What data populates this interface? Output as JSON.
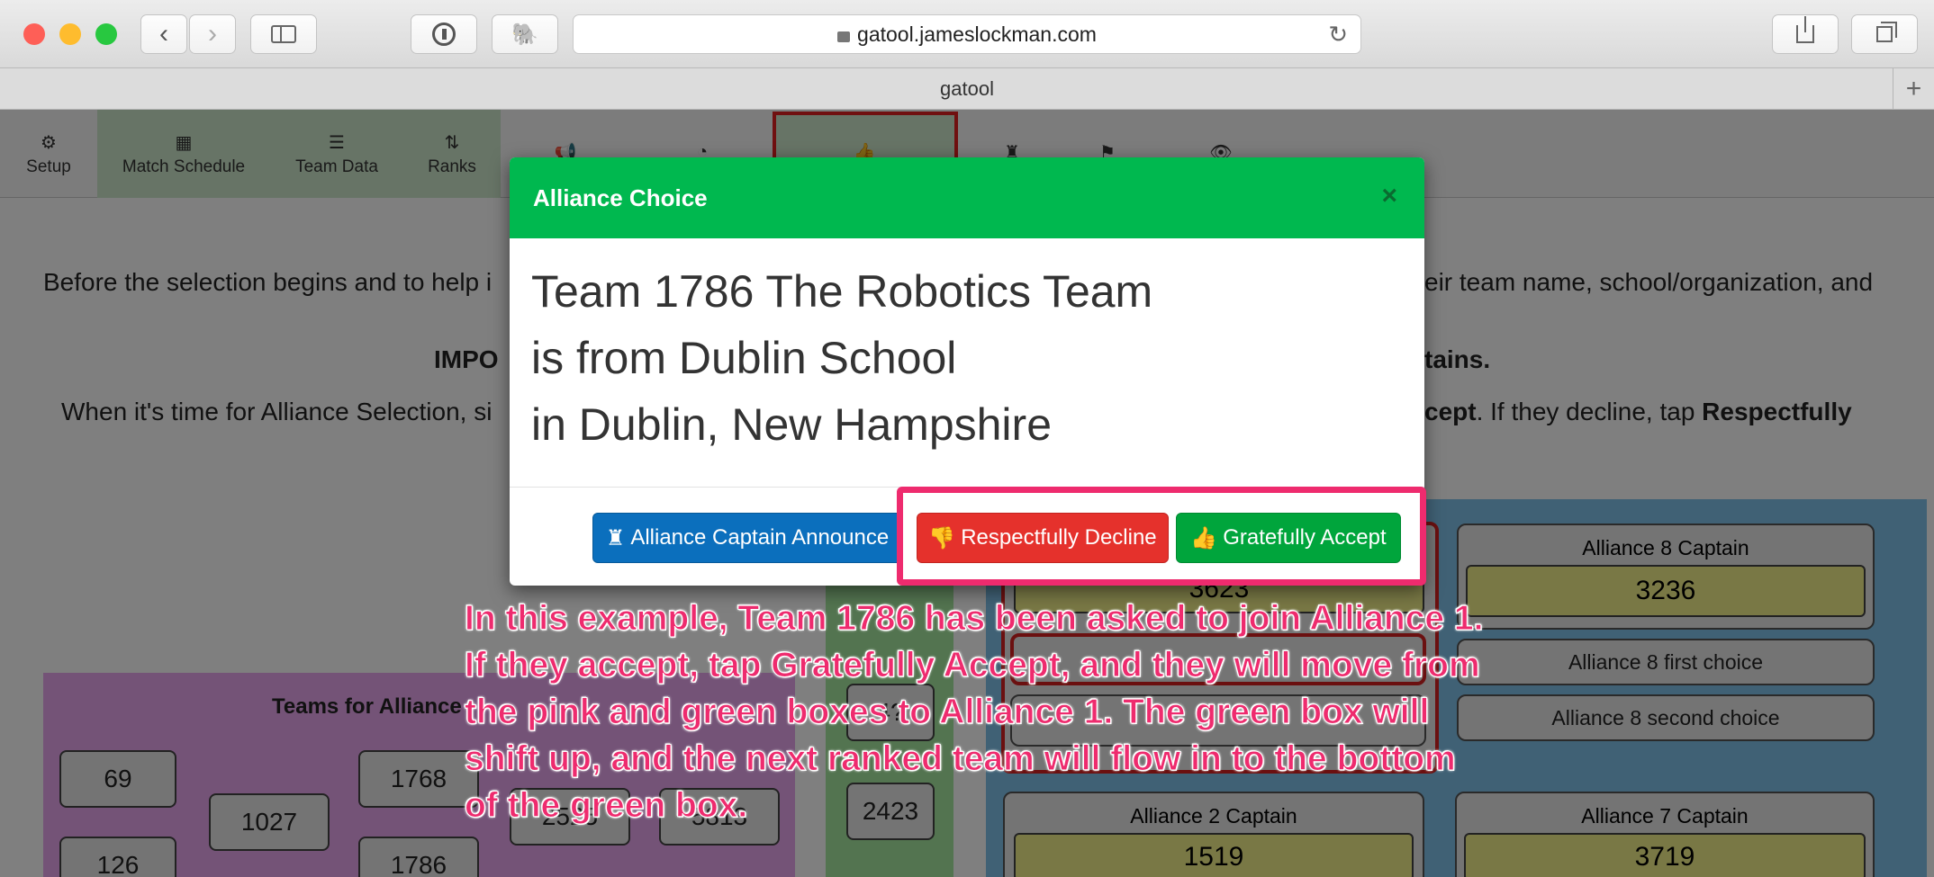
{
  "browser": {
    "url": "gatool.jameslockman.com",
    "tab_title": "gatool"
  },
  "nav": {
    "items": [
      {
        "label": "Setup",
        "icon": "gear-icon"
      },
      {
        "label": "Match Schedule",
        "icon": "calendar-icon"
      },
      {
        "label": "Team Data",
        "icon": "list-icon"
      },
      {
        "label": "Ranks",
        "icon": "sort-icon"
      },
      {
        "label": "",
        "icon": "megaphone-icon"
      },
      {
        "label": "",
        "icon": "gauge-icon"
      },
      {
        "label": "",
        "icon": "thumbs-up-icon"
      },
      {
        "label": "",
        "icon": "rook-icon"
      },
      {
        "label": "",
        "icon": "flag-icon"
      },
      {
        "label": "",
        "icon": "eye-icon"
      }
    ]
  },
  "page": {
    "para1_left": "Before the selection begins and to help i",
    "para1_right": "eir team name, school/organization, and",
    "important_left": "IMPO",
    "important_right": "tains.",
    "para2_left": "When it's time for Alliance Selection, si",
    "para2_accept": "cept",
    "para2_mid": ". If they decline, tap ",
    "para2_respect": "Respectfully"
  },
  "teams_panel": {
    "title": "Teams for Alliance",
    "teams": [
      "69",
      "1027",
      "1768",
      "126",
      "1786",
      "2525",
      "5813"
    ]
  },
  "green_panel": {
    "teams": [
      "4?",
      "2423"
    ]
  },
  "alliances": {
    "a8_captain_label": "Alliance 8 Captain",
    "a8_captain_team": "3236",
    "a8_first_choice": "Alliance 8 first choice",
    "a8_second_choice": "Alliance 8 second choice",
    "a1_captain_team": "3623",
    "a2_captain_label": "Alliance 2 Captain",
    "a2_captain_team": "1519",
    "a7_captain_label": "Alliance 7 Captain",
    "a7_captain_team": "3719"
  },
  "modal": {
    "title": "Alliance Choice",
    "close": "×",
    "line1": "Team 1786 The Robotics Team",
    "line2": "is from Dublin School",
    "line3": "in Dublin, New Hampshire",
    "btn_announce": "Alliance Captain Announce",
    "btn_decline": "Respectfully Decline",
    "btn_accept": "Gratefully Accept"
  },
  "annotation": {
    "lines": [
      "In this example, Team 1786 has been asked to join Alliance 1.",
      "If they accept, tap Gratefully Accept, and they will move from",
      "the pink and green boxes to Alliance 1. The green box will",
      "shift up, and the next ranked team will flow in to the bottom",
      "of the green box."
    ]
  },
  "colors": {
    "modal_header": "#00b84f",
    "decline": "#e5312c",
    "accept": "#00a53c",
    "announce": "#0b6fbd",
    "annotation": "#ee2b6e"
  }
}
